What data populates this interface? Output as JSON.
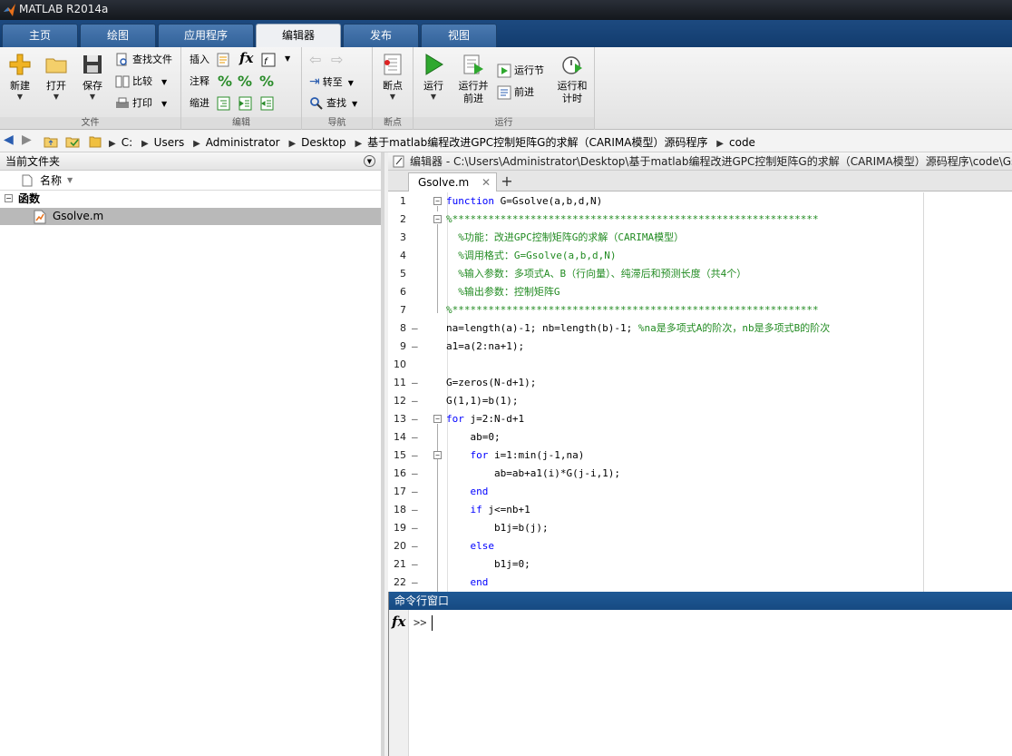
{
  "window": {
    "title": "MATLAB R2014a"
  },
  "tabs": [
    {
      "label": "主页",
      "active": false
    },
    {
      "label": "绘图",
      "active": false
    },
    {
      "label": "应用程序",
      "active": false
    },
    {
      "label": "编辑器",
      "active": true
    },
    {
      "label": "发布",
      "active": false
    },
    {
      "label": "视图",
      "active": false
    }
  ],
  "ribbon": {
    "file": {
      "label": "文件",
      "new": "新建",
      "open": "打开",
      "save": "保存",
      "find_files": "查找文件",
      "compare": "比较",
      "print": "打印"
    },
    "edit": {
      "label": "编辑",
      "insert": "插入",
      "comment": "注释",
      "indent": "缩进"
    },
    "navigate": {
      "label": "导航",
      "goto": "转至",
      "find": "查找"
    },
    "breakpoints": {
      "label": "断点",
      "button": "断点"
    },
    "run": {
      "label": "运行",
      "run": "运行",
      "run_advance": "运行并\n前进",
      "run_section": "运行节",
      "advance": "前进",
      "run_time": "运行和\n计时"
    }
  },
  "address": {
    "crumbs": [
      "C:",
      "Users",
      "Administrator",
      "Desktop",
      "基于matlab编程改进GPC控制矩阵G的求解（CARIMA模型）源码程序",
      "code"
    ]
  },
  "current_folder": {
    "title": "当前文件夹",
    "column_name": "名称",
    "group": "函数",
    "files": [
      "Gsolve.m"
    ]
  },
  "editor": {
    "title": "编辑器 - C:\\Users\\Administrator\\Desktop\\基于matlab编程改进GPC控制矩阵G的求解（CARIMA模型）源码程序\\code\\Gsolve.m",
    "tab": "Gsolve.m",
    "lines": [
      {
        "n": "1",
        "mark": "",
        "fold": "−",
        "html": "<span class='kw'>function</span> G=Gsolve(a,b,d,N)"
      },
      {
        "n": "2",
        "mark": "",
        "fold": "−",
        "html": "<span class='cm'>%*************************************************************</span>"
      },
      {
        "n": "3",
        "mark": "",
        "fold": "",
        "html": "  <span class='cm'>%功能：改进GPC控制矩阵G的求解（CARIMA模型）</span>"
      },
      {
        "n": "4",
        "mark": "",
        "fold": "",
        "html": "  <span class='cm'>%调用格式：G=Gsolve(a,b,d,N)</span>"
      },
      {
        "n": "5",
        "mark": "",
        "fold": "",
        "html": "  <span class='cm'>%输入参数：多项式A、B（行向量）、纯滞后和预测长度（共4个）</span>"
      },
      {
        "n": "6",
        "mark": "",
        "fold": "",
        "html": "  <span class='cm'>%输出参数：控制矩阵G</span>"
      },
      {
        "n": "7",
        "mark": "",
        "fold": "",
        "html": "<span class='cm'>%*************************************************************</span>"
      },
      {
        "n": "8",
        "mark": "–",
        "fold": "",
        "html": "na=length(a)-1; nb=length(b)-1; <span class='cm'>%na是多项式A的阶次，nb是多项式B的阶次</span>"
      },
      {
        "n": "9",
        "mark": "–",
        "fold": "",
        "html": "a1=a(2:na+1);"
      },
      {
        "n": "10",
        "mark": "",
        "fold": "",
        "html": ""
      },
      {
        "n": "11",
        "mark": "–",
        "fold": "",
        "html": "G=zeros(N-d+1);"
      },
      {
        "n": "12",
        "mark": "–",
        "fold": "",
        "html": "G(1,1)=b(1);"
      },
      {
        "n": "13",
        "mark": "–",
        "fold": "−",
        "html": "<span class='kw'>for</span> j=2:N-d+1"
      },
      {
        "n": "14",
        "mark": "–",
        "fold": "",
        "html": "    ab=0;"
      },
      {
        "n": "15",
        "mark": "–",
        "fold": "−",
        "html": "    <span class='kw'>for</span> i=1:min(j-1,na)"
      },
      {
        "n": "16",
        "mark": "–",
        "fold": "",
        "html": "        ab=ab+a1(i)*G(j-i,1);"
      },
      {
        "n": "17",
        "mark": "–",
        "fold": "",
        "html": "    <span class='kw'>end</span>"
      },
      {
        "n": "18",
        "mark": "–",
        "fold": "",
        "html": "    <span class='kw'>if</span> j&lt;=nb+1"
      },
      {
        "n": "19",
        "mark": "–",
        "fold": "",
        "html": "        b1j=b(j);"
      },
      {
        "n": "20",
        "mark": "–",
        "fold": "",
        "html": "    <span class='kw'>else</span>"
      },
      {
        "n": "21",
        "mark": "–",
        "fold": "",
        "html": "        b1j=0;"
      },
      {
        "n": "22",
        "mark": "–",
        "fold": "",
        "html": "    <span class='kw'>end</span>"
      }
    ]
  },
  "command_window": {
    "title": "命令行窗口",
    "prompt": ">>"
  },
  "colors": {
    "keyword": "#0000ff",
    "comment": "#228b22",
    "tab_bar": "#1d4a80",
    "cmd_header": "#1f5996"
  }
}
